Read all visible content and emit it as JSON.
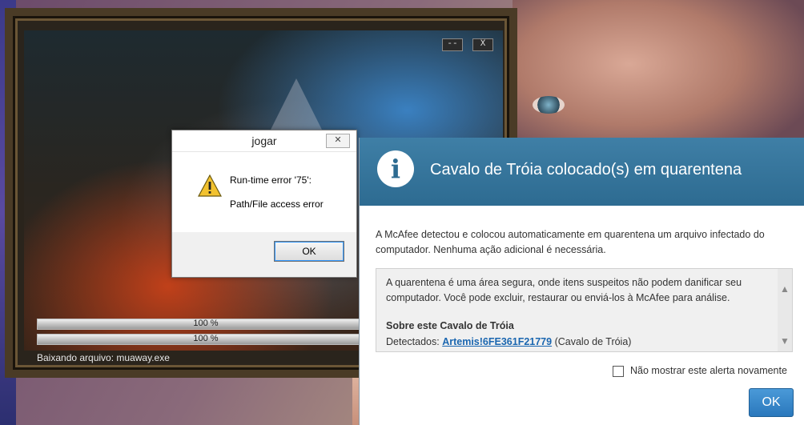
{
  "launcher": {
    "minimize_label": "--",
    "close_label": "X",
    "progress": [
      {
        "label": "100 %",
        "fraction": 1.0
      },
      {
        "label": "100 %",
        "fraction": 1.0
      }
    ],
    "download_status": "Baixando arquivo: muaway.exe"
  },
  "jogar_dialog": {
    "title": "jogar",
    "close_glyph": "✕",
    "icon": "warning-icon",
    "message_line1": "Run-time error '75':",
    "message_line2": "Path/File access error",
    "ok_label": "OK"
  },
  "mcafee_alert": {
    "icon": "info-icon",
    "title": "Cavalo de Tróia colocado(s) em quarentena",
    "intro": "A McAfee detectou e colocou automaticamente em quarentena um arquivo infectado do computador. Nenhuma ação adicional é necessária.",
    "box_text": "A quarentena é uma área segura, onde itens suspeitos não podem danificar seu computador. Você pode excluir, restaurar ou enviá-los à McAfee para análise.",
    "about_heading": "Sobre este Cavalo de Tróia",
    "detected_label": "Detectados:",
    "detected_link": "Artemis!6FE361F21779",
    "detected_suffix": "(Cavalo de Tróia)",
    "checkbox_label": "Não mostrar este alerta novamente",
    "checkbox_checked": false,
    "ok_label": "OK",
    "header_color": "#3f7fa6",
    "link_color": "#1a66b0"
  }
}
